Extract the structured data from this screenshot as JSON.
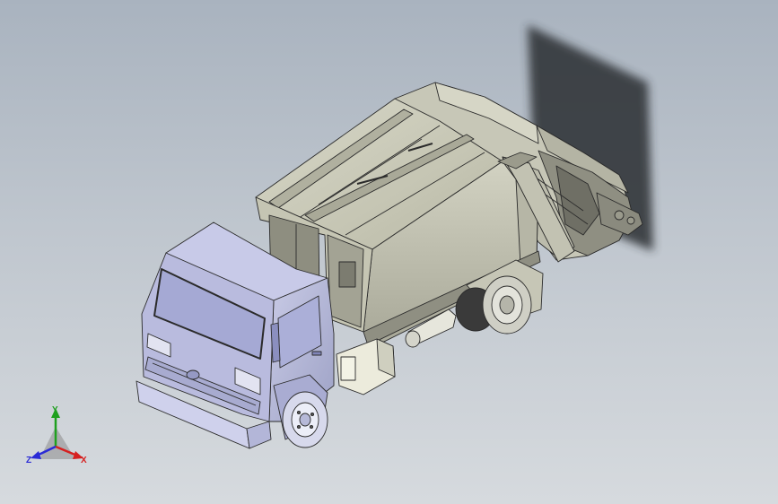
{
  "viewport": {
    "background_top": "#a9b3bf",
    "background_bottom": "#d6dade",
    "model": "garbage-compactor-truck"
  },
  "triad": {
    "x_label": "X",
    "y_label": "Y",
    "z_label": "Z",
    "x_color": "#d62020",
    "y_color": "#1fa01f",
    "z_color": "#2a2ad6"
  }
}
